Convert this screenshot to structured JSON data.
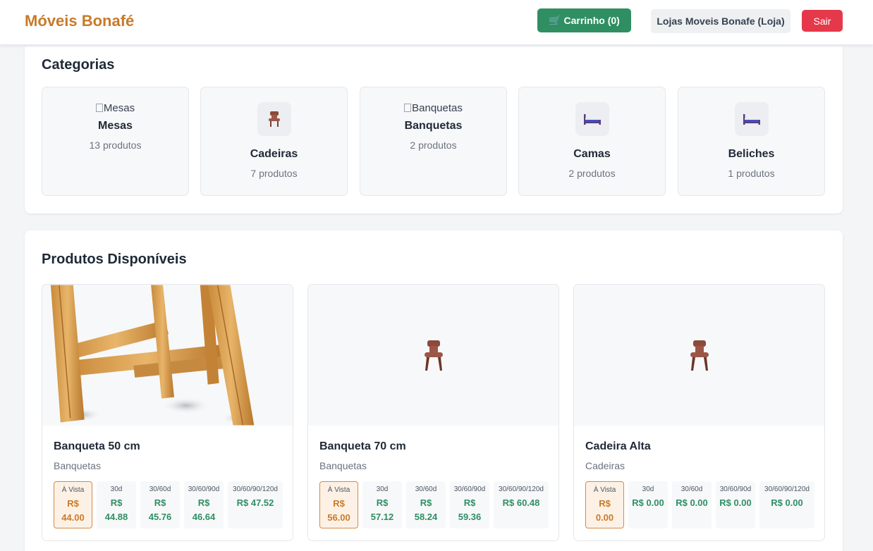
{
  "header": {
    "brand": "Móveis Bonafé",
    "cart_label": "🛒 Carrinho (0)",
    "store_label": "Lojas Moveis Bonafe (Loja)",
    "exit_label": "Sair"
  },
  "categories": {
    "title": "Categorias",
    "items": [
      {
        "name": "Mesas",
        "count": "13 produtos",
        "image_alt": "Mesas",
        "icon": "broken-image"
      },
      {
        "name": "Cadeiras",
        "count": "7 produtos",
        "icon": "chair-icon"
      },
      {
        "name": "Banquetas",
        "count": "2 produtos",
        "image_alt": "Banquetas",
        "icon": "broken-image"
      },
      {
        "name": "Camas",
        "count": "2 produtos",
        "icon": "bed-icon"
      },
      {
        "name": "Beliches",
        "count": "1 produtos",
        "icon": "bed-icon"
      }
    ]
  },
  "products": {
    "title": "Produtos Disponíveis",
    "items": [
      {
        "name": "Banqueta 50 cm",
        "category": "Banquetas",
        "image": "wooden-stool-photo",
        "prices": [
          {
            "label": "À Vista",
            "value": "R$ 44.00"
          },
          {
            "label": "30d",
            "value": "R$ 44.88"
          },
          {
            "label": "30/60d",
            "value": "R$ 45.76"
          },
          {
            "label": "30/60/90d",
            "value": "R$ 46.64"
          },
          {
            "label": "30/60/90/120d",
            "value": "R$ 47.52"
          }
        ]
      },
      {
        "name": "Banqueta 70 cm",
        "category": "Banquetas",
        "image": "chair-icon",
        "prices": [
          {
            "label": "À Vista",
            "value": "R$ 56.00"
          },
          {
            "label": "30d",
            "value": "R$ 57.12"
          },
          {
            "label": "30/60d",
            "value": "R$ 58.24"
          },
          {
            "label": "30/60/90d",
            "value": "R$ 59.36"
          },
          {
            "label": "30/60/90/120d",
            "value": "R$ 60.48"
          }
        ]
      },
      {
        "name": "Cadeira Alta",
        "category": "Cadeiras",
        "image": "chair-icon",
        "prices": [
          {
            "label": "À Vista",
            "value": "R$ 0.00"
          },
          {
            "label": "30d",
            "value": "R$ 0.00"
          },
          {
            "label": "30/60d",
            "value": "R$ 0.00"
          },
          {
            "label": "30/60/90d",
            "value": "R$ 0.00"
          },
          {
            "label": "30/60/90/120d",
            "value": "R$ 0.00"
          }
        ]
      }
    ]
  },
  "colors": {
    "brand": "#c87a2a",
    "cart_button": "#2f8f63",
    "exit_button": "#e5394b",
    "price_green": "#2f8f63",
    "cash_orange": "#c87a2a"
  }
}
